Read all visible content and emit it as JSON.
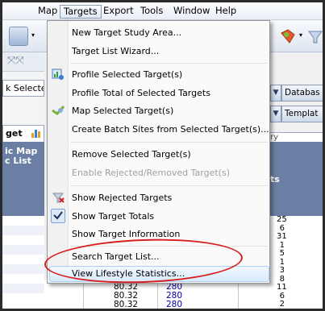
{
  "menubar": {
    "items": [
      "Map",
      "Targets",
      "Export",
      "Tools",
      "Window",
      "Help"
    ]
  },
  "left": {
    "combo_text": "k Selecte",
    "tab_label": "get",
    "grid_header": "ic Map\nc List"
  },
  "right": {
    "database_label": "Databas",
    "template_label": "Templat",
    "column_tail": "ry",
    "header_fragment": "ts",
    "col_values": [
      "25",
      "6",
      "31",
      "1",
      "5",
      "1",
      "3",
      "8",
      "11",
      "6",
      "2"
    ]
  },
  "grid_rows": [
    {
      "v1": "80.32",
      "v2": "280"
    },
    {
      "v1": "80.32",
      "v2": "280"
    },
    {
      "v1": "80.32",
      "v2": "280"
    }
  ],
  "dropdown": {
    "items": [
      {
        "label": "New Target Study Area...",
        "icon": ""
      },
      {
        "label": "Target List Wizard...",
        "icon": ""
      },
      {
        "label": "Profile Selected Target(s)",
        "icon": "profile-icon"
      },
      {
        "label": "Profile Total of Selected Targets",
        "icon": ""
      },
      {
        "label": "Map Selected Target(s)",
        "icon": "map-target-icon"
      },
      {
        "label": "Create Batch Sites from Selected Target(s)...",
        "icon": ""
      },
      {
        "label": "Remove Selected Target(s)",
        "icon": ""
      },
      {
        "label": "Enable Rejected/Removed Target(s)",
        "icon": "",
        "disabled": true
      },
      {
        "label": "Show Rejected Targets",
        "icon": "filter-icon"
      },
      {
        "label": "Show Target Totals",
        "icon": "checkmark-icon",
        "checked": true
      },
      {
        "label": "Show Target Information",
        "icon": ""
      },
      {
        "label": "Search Target List...",
        "icon": ""
      },
      {
        "label": "View Lifestyle Statistics...",
        "icon": ""
      }
    ]
  },
  "colors": {
    "highlight_oval": "#d81e1e",
    "grid_header": "#6a7fa3",
    "value_blue": "#0000aa"
  }
}
